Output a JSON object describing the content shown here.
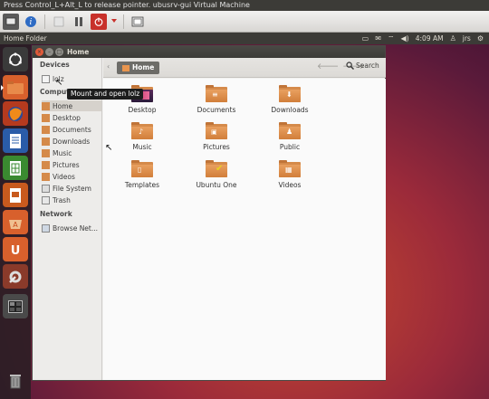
{
  "vm": {
    "title": "Press Control_L+Alt_L to release pointer. ubusrv-gui Virtual Machine",
    "toolbar_icons": [
      "screen-icon",
      "info-icon",
      "play-icon",
      "pause-icon",
      "power-icon",
      "dropdown-arrow-icon",
      "fullscreen-icon"
    ]
  },
  "panel": {
    "window_title": "Home Folder",
    "time": "4:09 AM",
    "user": "jrs"
  },
  "window": {
    "title": "Home"
  },
  "sidebar": {
    "devices_heading": "Devices",
    "device_item": "lolz",
    "computer_heading": "Computer",
    "computer_items": [
      "Home",
      "Desktop",
      "Documents",
      "Downloads",
      "Music",
      "Pictures",
      "Videos",
      "File System",
      "Trash"
    ],
    "network_heading": "Network",
    "network_items": [
      "Browse Net..."
    ]
  },
  "toolbar": {
    "breadcrumb": "Home",
    "search_label": "Search"
  },
  "files": [
    "Desktop",
    "Documents",
    "Downloads",
    "Music",
    "Pictures",
    "Public",
    "Templates",
    "Ubuntu One",
    "Videos"
  ],
  "tooltip": "Mount and open lolz",
  "colors": {
    "folder": "#d58a4a",
    "panel": "#3c3b37",
    "selection": "#d6d2cc"
  }
}
